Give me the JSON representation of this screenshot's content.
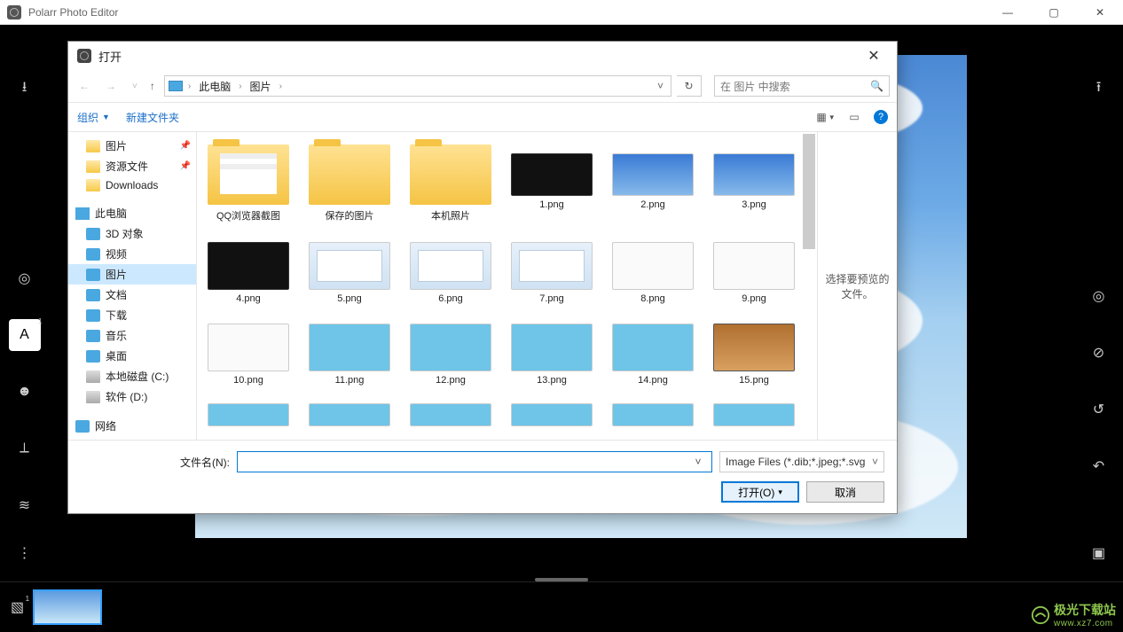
{
  "app": {
    "title": "Polarr Photo Editor"
  },
  "window_controls": {
    "min": "—",
    "max": "▢",
    "close": "✕"
  },
  "left_tools": [
    {
      "name": "import-icon",
      "glyph": "⭳"
    },
    {
      "name": "adjust-icon",
      "glyph": "◎"
    },
    {
      "name": "text-icon",
      "glyph": "A",
      "active": true,
      "badge": "1"
    },
    {
      "name": "face-icon",
      "glyph": "☻"
    },
    {
      "name": "crop-icon",
      "glyph": "⟂"
    },
    {
      "name": "layers-icon",
      "glyph": "≋"
    }
  ],
  "left_bottom": {
    "name": "more-icon",
    "glyph": "⋮"
  },
  "right_tools": [
    {
      "name": "export-icon",
      "glyph": "⭱"
    },
    {
      "name": "spiral-icon",
      "glyph": "◎"
    },
    {
      "name": "denoise-icon",
      "glyph": "⊘"
    },
    {
      "name": "history-icon",
      "glyph": "↺"
    },
    {
      "name": "undo-icon",
      "glyph": "↶"
    }
  ],
  "right_bottom": {
    "name": "compare-icon",
    "glyph": "▣"
  },
  "filmstrip": {
    "icon": "▧",
    "badge": "1"
  },
  "watermark": {
    "text": "极光下载站",
    "url": "www.xz7.com"
  },
  "dialog": {
    "title": "打开",
    "nav": {
      "back": "←",
      "forward": "→",
      "recent": "˅",
      "up": "↑"
    },
    "breadcrumb": {
      "root": "此电脑",
      "folder": "图片"
    },
    "refresh": "↻",
    "search_placeholder": "在 图片 中搜索",
    "toolbar": {
      "organize": "组织",
      "newfolder": "新建文件夹",
      "view": "▦",
      "preview": "▭",
      "help": "?"
    },
    "tree": [
      {
        "label": "图片",
        "icon": "folder",
        "pinned": true
      },
      {
        "label": "资源文件",
        "icon": "folder",
        "pinned": true
      },
      {
        "label": "Downloads",
        "icon": "folder"
      },
      {
        "spacer": true
      },
      {
        "label": "此电脑",
        "icon": "pc",
        "bold": true
      },
      {
        "label": "3D 对象",
        "icon": "blue"
      },
      {
        "label": "视频",
        "icon": "blue"
      },
      {
        "label": "图片",
        "icon": "blue",
        "selected": true
      },
      {
        "label": "文档",
        "icon": "blue"
      },
      {
        "label": "下载",
        "icon": "blue"
      },
      {
        "label": "音乐",
        "icon": "blue"
      },
      {
        "label": "桌面",
        "icon": "blue"
      },
      {
        "label": "本地磁盘 (C:)",
        "icon": "drive"
      },
      {
        "label": "软件 (D:)",
        "icon": "drive"
      },
      {
        "spacer": true
      },
      {
        "label": "网络",
        "icon": "net"
      }
    ],
    "files": [
      {
        "label": "QQ浏览器截图",
        "kind": "folder docs"
      },
      {
        "label": "保存的图片",
        "kind": "folder"
      },
      {
        "label": "本机照片",
        "kind": "folder"
      },
      {
        "label": "1.png",
        "kind": "dark wide"
      },
      {
        "label": "2.png",
        "kind": "sky wide"
      },
      {
        "label": "3.png",
        "kind": "sky wide"
      },
      {
        "label": "4.png",
        "kind": "dark short"
      },
      {
        "label": "5.png",
        "kind": "screenshot short"
      },
      {
        "label": "6.png",
        "kind": "screenshot short"
      },
      {
        "label": "7.png",
        "kind": "screenshot short"
      },
      {
        "label": "8.png",
        "kind": "white short"
      },
      {
        "label": "9.png",
        "kind": "white short"
      },
      {
        "label": "10.png",
        "kind": "white short"
      },
      {
        "label": "11.png",
        "kind": "diagram short"
      },
      {
        "label": "12.png",
        "kind": "diagram short"
      },
      {
        "label": "13.png",
        "kind": "teal short"
      },
      {
        "label": "14.png",
        "kind": "teal short"
      },
      {
        "label": "15.png",
        "kind": "photo short"
      },
      {
        "label": "",
        "kind": "teal mini"
      },
      {
        "label": "",
        "kind": "teal mini"
      },
      {
        "label": "",
        "kind": "teal mini"
      },
      {
        "label": "",
        "kind": "teal mini"
      },
      {
        "label": "",
        "kind": "teal mini"
      },
      {
        "label": "",
        "kind": "teal mini"
      }
    ],
    "preview_hint": "选择要预览的文件。",
    "filename_label": "文件名(N):",
    "filename_value": "",
    "filter": "Image Files (*.dib;*.jpeg;*.svg",
    "open_btn": "打开(O)",
    "cancel_btn": "取消"
  }
}
